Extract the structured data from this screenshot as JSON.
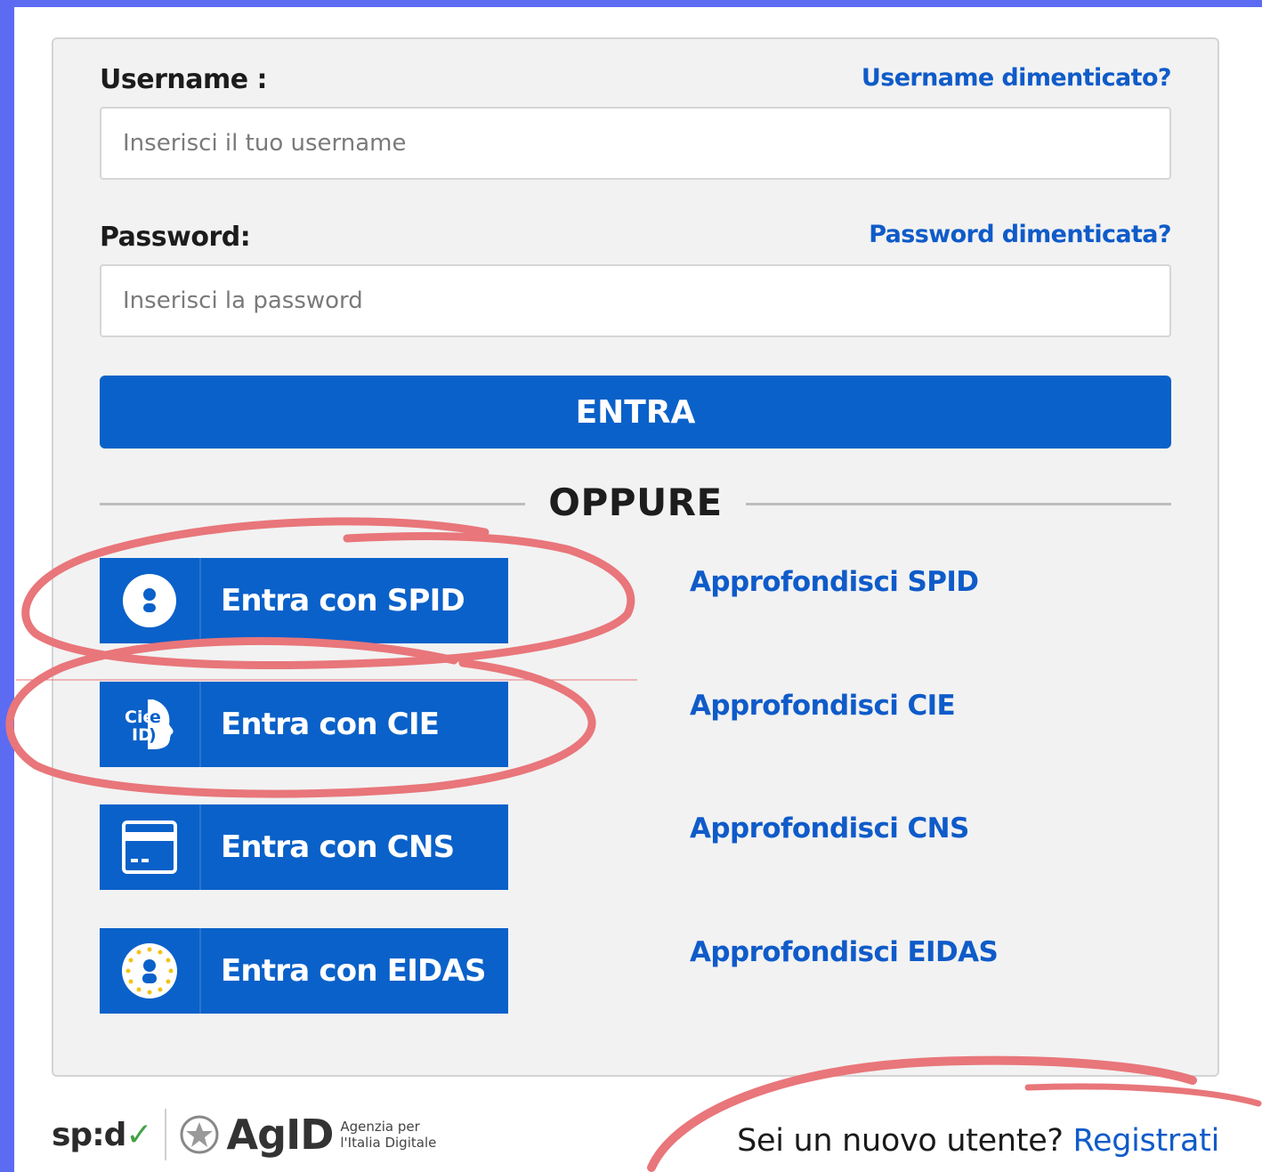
{
  "colors": {
    "frame": "#5b6cf3",
    "primary_button": "#0a61c9",
    "link": "#0f5bc9",
    "card_bg": "#f2f2f2",
    "annotation": "#e8767a"
  },
  "login": {
    "username_label": "Username :",
    "username_forgot": "Username dimenticato?",
    "username_placeholder": "Inserisci il tuo username",
    "password_label": "Password:",
    "password_forgot": "Password dimenticata?",
    "password_placeholder": "Inserisci la password",
    "submit_label": "ENTRA",
    "separator": "OPPURE"
  },
  "auth_methods": [
    {
      "label": "Entra con SPID",
      "more": "Approfondisci SPID",
      "icon": "user-circle-icon"
    },
    {
      "label": "Entra con CIE",
      "more": "Approfondisci CIE",
      "icon": "cie-id-icon"
    },
    {
      "label": "Entra con CNS",
      "more": "Approfondisci CNS",
      "icon": "card-icon"
    },
    {
      "label": "Entra con EIDAS",
      "more": "Approfondisci EIDAS",
      "icon": "eidas-user-icon"
    }
  ],
  "footer": {
    "spid_logo": "sp:d",
    "agid_logo": "AgID",
    "agid_line1": "Agenzia per",
    "agid_line2": "l'Italia Digitale",
    "new_user_question": "Sei un nuovo utente?",
    "register_link": "Registrati"
  }
}
